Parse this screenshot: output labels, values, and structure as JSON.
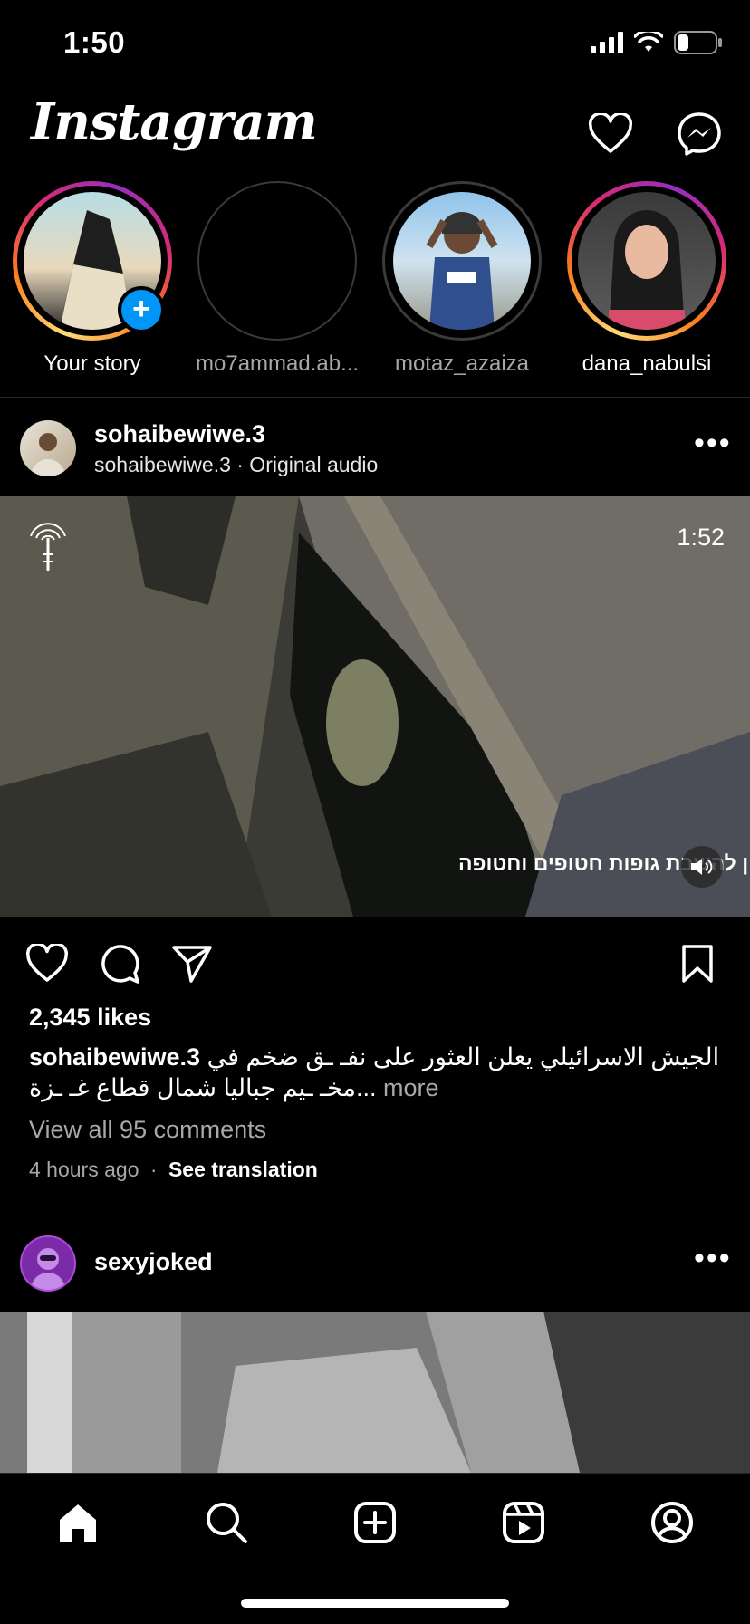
{
  "status_bar": {
    "time": "1:50"
  },
  "header": {
    "logo": "Instagram"
  },
  "stories": [
    {
      "label": "Your story",
      "ring": "gradient",
      "has_add_badge": true,
      "add_badge": "+"
    },
    {
      "label": "mo7ammad.ab...",
      "ring": "grey"
    },
    {
      "label": "motaz_azaiza",
      "ring": "grey"
    },
    {
      "label": "dana_nabulsi",
      "ring": "gradient"
    }
  ],
  "post1": {
    "username": "sohaibewiwe.3",
    "subline": "sohaibewiwe.3 · Original audio",
    "video_duration": "1:52",
    "overlay_text": "ן להשבת גופות חטופים וחטופה",
    "likes": "2,345 likes",
    "caption_user": "sohaibewiwe.3",
    "caption_line1": "الجيش الاسرائيلي يعلن العثور على نفـ ـق ضخم في",
    "caption_line2": "مخـ ـيم جباليا شمال قطاع غـ ـزة",
    "caption_more": "more",
    "caption_ellipsis": "...",
    "view_comments": "View all 95 comments",
    "time_ago": "4 hours ago",
    "meta_separator": "·",
    "see_translation": "See translation"
  },
  "post2": {
    "username": "sexyjoked"
  },
  "colors": {
    "accent": "#0095f6",
    "muted": "#a8a8a8",
    "background": "#000000"
  },
  "icons": {
    "header": [
      "heart-icon",
      "messenger-icon"
    ],
    "post_actions": [
      "heart-icon",
      "comment-icon",
      "send-icon",
      "bookmark-icon"
    ],
    "nav": [
      "home-icon",
      "search-icon",
      "create-icon",
      "reels-icon",
      "profile-icon"
    ]
  }
}
